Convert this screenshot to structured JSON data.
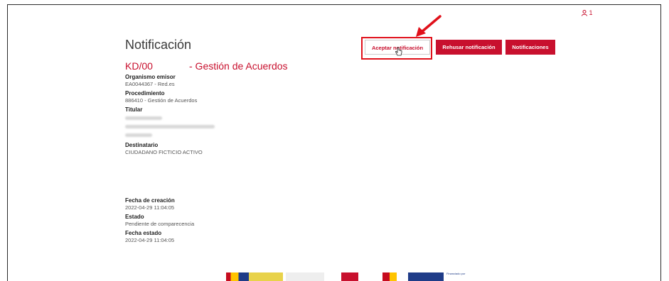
{
  "header": {
    "user_label": "1"
  },
  "page": {
    "title": "Notificación"
  },
  "notification": {
    "code": "KD/00",
    "subject": "- Gestión de Acuerdos"
  },
  "actions": {
    "accept_label": "Aceptar notificación",
    "reject_label": "Rehusar notificación",
    "list_label": "Notificaciones"
  },
  "fields": {
    "organismo_label": "Organismo emisor",
    "organismo_value": "EA0044367 - Red.es",
    "procedimiento_label": "Procedimiento",
    "procedimiento_value": "886410 - Gestión de Acuerdos",
    "titular_label": "Titular",
    "destinatario_label": "Destinatario",
    "destinatario_value": "CIUDADANO FICTICIO ACTIVO",
    "fecha_creacion_label": "Fecha de creación",
    "fecha_creacion_value": "2022-04-29 11:04:05",
    "estado_label": "Estado",
    "estado_value": "Pendiente de comparecencia",
    "fecha_estado_label": "Fecha estado",
    "fecha_estado_value": "2022-04-29 11:04:05"
  },
  "footer": {
    "funding_text": "Financiado por"
  },
  "colors": {
    "brand_red": "#c8102e",
    "annotation_red": "#e0101a"
  }
}
